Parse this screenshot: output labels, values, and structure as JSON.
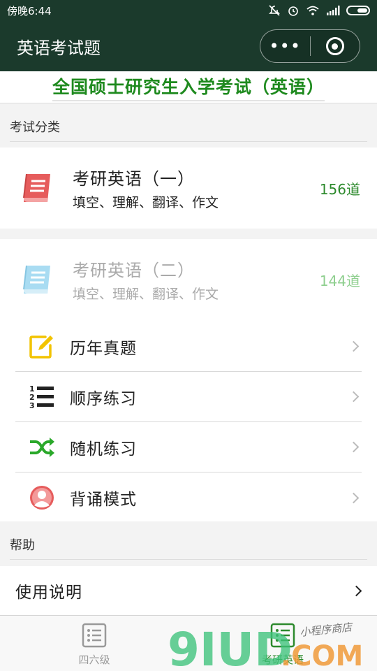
{
  "status_bar": {
    "time": "傍晚6:44"
  },
  "nav": {
    "title": "英语考试题",
    "more_label": "•••"
  },
  "banner": {
    "text": "全国硕士研究生入学考试（英语）"
  },
  "sections": {
    "category": "考试分类",
    "help": "帮助"
  },
  "categories": [
    {
      "title": "考研英语（一）",
      "subtitle": "填空、理解、翻译、作文",
      "count": "156道",
      "icon": "book-icon",
      "color": "#e65c5c"
    },
    {
      "title": "考研英语（二）",
      "subtitle": "填空、理解、翻译、作文",
      "count": "144道",
      "icon": "book-icon",
      "color": "#a9dcf2"
    }
  ],
  "menu": [
    {
      "label": "历年真题",
      "icon": "edit-icon",
      "color": "#f2c300"
    },
    {
      "label": "顺序练习",
      "icon": "ordered-list-icon",
      "color": "#222222"
    },
    {
      "label": "随机练习",
      "icon": "shuffle-icon",
      "color": "#2aa82a"
    },
    {
      "label": "背诵模式",
      "icon": "user-icon",
      "color": "#e65c5c"
    }
  ],
  "help": {
    "label": "使用说明"
  },
  "tabs": [
    {
      "label": "四六级",
      "icon": "list-icon",
      "active": false
    },
    {
      "label": "考研英语",
      "icon": "list-icon",
      "active": true
    }
  ],
  "watermark": {
    "text": "9IUD.COM",
    "subtext": "小程序商店"
  },
  "colors": {
    "nav_bg": "#1b3a2c",
    "accent_green": "#2d8a2d",
    "banner_green": "#1e8a1e"
  }
}
